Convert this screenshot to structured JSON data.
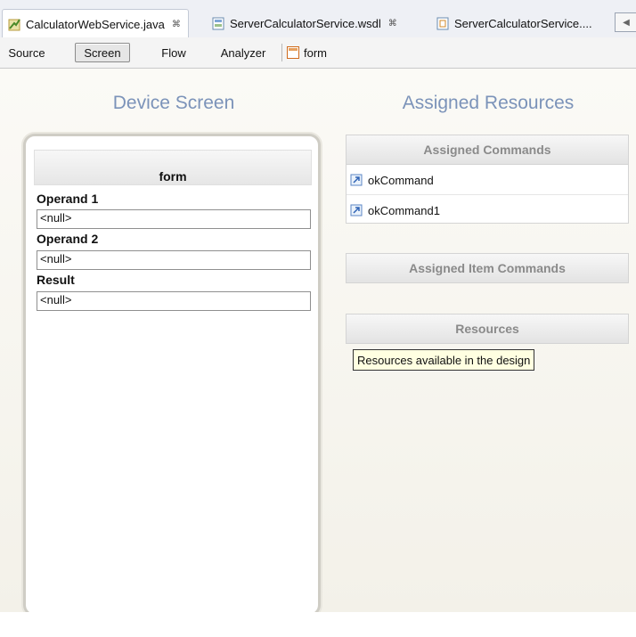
{
  "tabs": [
    {
      "label": "CalculatorWebService.java",
      "icon": "java-file-icon",
      "active": true,
      "close": "⌘"
    },
    {
      "label": "ServerCalculatorService.wsdl",
      "icon": "wsdl-file-icon",
      "active": false,
      "close": "⌘"
    },
    {
      "label": "ServerCalculatorService....",
      "icon": "mobile-file-icon",
      "active": false
    }
  ],
  "toolbar": {
    "views": [
      "Source",
      "Screen",
      "Flow",
      "Analyzer"
    ],
    "selected_view": "Screen",
    "form_selector": "form"
  },
  "device_screen": {
    "title": "Device Screen",
    "form_title": "form",
    "fields": [
      {
        "label": "Operand 1",
        "value": "<null>"
      },
      {
        "label": "Operand 2",
        "value": "<null>"
      },
      {
        "label": "Result",
        "value": "<null>"
      }
    ]
  },
  "assigned_resources": {
    "title": "Assigned Resources",
    "commands_header": "Assigned Commands",
    "commands": [
      "okCommand",
      "okCommand1"
    ],
    "item_commands_header": "Assigned Item Commands",
    "resources_header": "Resources",
    "tooltip": "Resources available in the design"
  },
  "colors": {
    "title_blue": "#7b93b9",
    "header_text": "#8a8a8a",
    "tooltip_bg": "#ffffe1"
  }
}
